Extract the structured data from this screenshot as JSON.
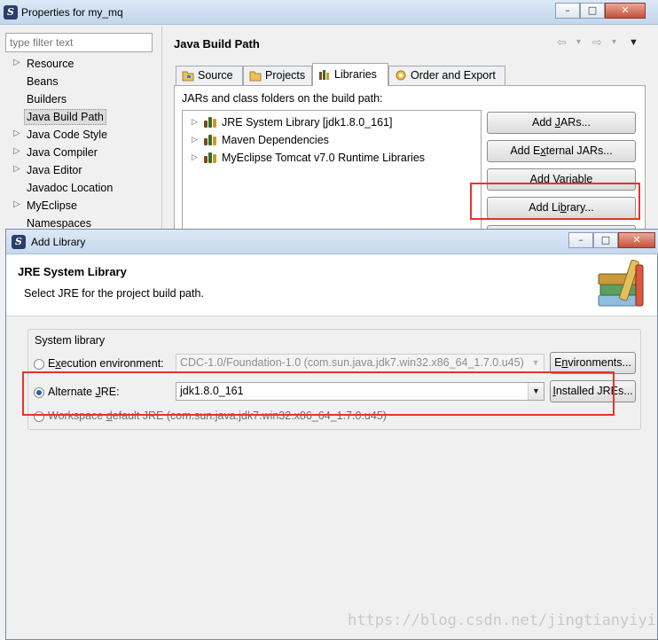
{
  "properties_window": {
    "title": "Properties for my_mq",
    "window_buttons": [
      "–",
      "□",
      "✕"
    ],
    "filter_placeholder": "type filter text",
    "nav_items": [
      {
        "label": "Resource",
        "expander": "▷"
      },
      {
        "label": "Beans",
        "expander": ""
      },
      {
        "label": "Builders",
        "expander": ""
      },
      {
        "label": "Java Build Path",
        "expander": "",
        "selected": true
      },
      {
        "label": "Java Code Style",
        "expander": "▷"
      },
      {
        "label": "Java Compiler",
        "expander": "▷"
      },
      {
        "label": "Java Editor",
        "expander": "▷"
      },
      {
        "label": "Javadoc Location",
        "expander": ""
      },
      {
        "label": "MyEclipse",
        "expander": "▷"
      },
      {
        "label": "Namespaces",
        "expander": ""
      }
    ],
    "page_title": "Java Build Path",
    "nav_arrows": [
      "⇦",
      "▾",
      "⇨",
      "▾",
      "▼"
    ],
    "tabs": [
      {
        "label": "Source",
        "icon": "source-folder-icon"
      },
      {
        "label": "Projects",
        "icon": "projects-icon"
      },
      {
        "label": "Libraries",
        "icon": "libraries-icon",
        "active": true
      },
      {
        "label": "Order and Export",
        "icon": "order-export-icon"
      }
    ],
    "jars_label": "JARs and class folders on the build path:",
    "libraries": [
      "JRE System Library [jdk1.8.0_161]",
      "Maven Dependencies",
      "MyEclipse Tomcat v7.0 Runtime Libraries"
    ],
    "buttons": {
      "add_jars": {
        "pre": "Add ",
        "mn": "J",
        "post": "ARs..."
      },
      "add_external_jars": {
        "pre": "Add E",
        "mn": "x",
        "post": "ternal JARs..."
      },
      "add_variable": {
        "pre": "Add ",
        "mn": "V",
        "post": "ariable"
      },
      "add_library": {
        "pre": "Add Li",
        "mn": "b",
        "post": "rary..."
      }
    },
    "expander_glyph": "▷"
  },
  "add_library_dialog": {
    "title": "Add Library",
    "window_buttons": [
      "–",
      "□",
      "✕"
    ],
    "heading": "JRE System Library",
    "subheading": "Select JRE for the project build path.",
    "group_title": "System library",
    "options": {
      "execution_env": {
        "pre": "E",
        "mn": "x",
        "post": "ecution environment:",
        "value": "CDC-1.0/Foundation-1.0 (com.sun.java.jdk7.win32.x86_64_1.7.0.u45)",
        "button": {
          "pre": "E",
          "mn": "n",
          "post": "vironments..."
        }
      },
      "alternate_jre": {
        "pre": "Alternate ",
        "mn": "J",
        "post": "RE:",
        "value": "jdk1.8.0_161",
        "button": {
          "pre": "",
          "mn": "I",
          "post": "nstalled JREs..."
        },
        "selected": true
      },
      "workspace_default": {
        "pre": "Workspace ",
        "mn": "d",
        "post": "efault JRE (com.sun.java.jdk7.win32.x86_64_1.7.0.u45)"
      }
    },
    "combo_arrow": "▼"
  },
  "watermark": "https://blog.csdn.net/jingtianyiyi",
  "colors": {
    "highlight_box": "#e0362c",
    "radio_selected": "#2a5cb8",
    "titlebar": "#c7d9ee"
  }
}
